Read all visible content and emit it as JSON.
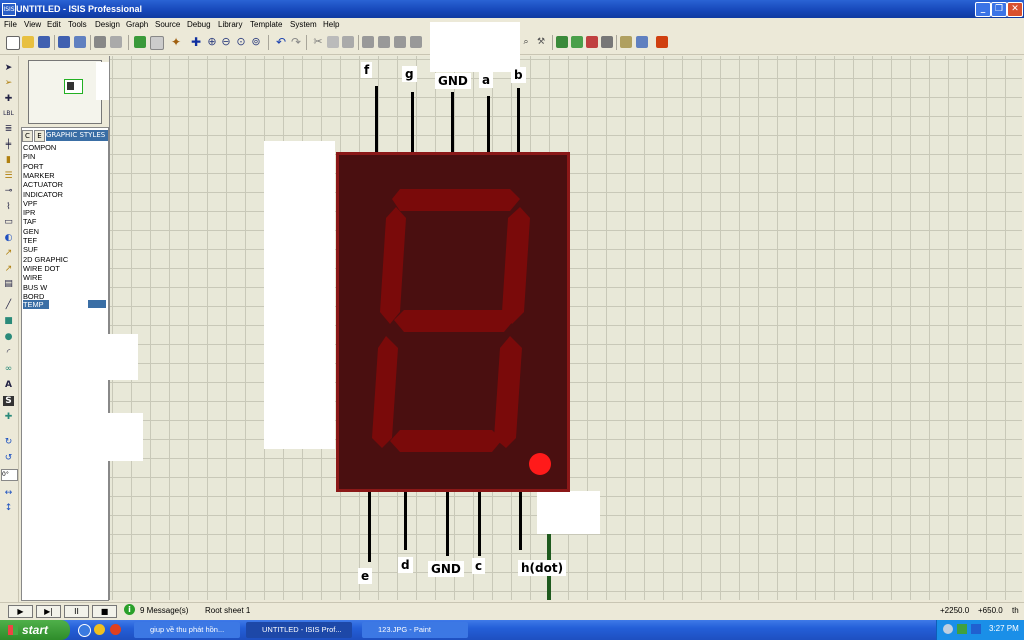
{
  "window": {
    "title": "UNTITLED - ISIS Professional",
    "app_icon_text": "ISIS",
    "controls": [
      "_",
      "❐",
      "✕"
    ]
  },
  "menu": [
    "File",
    "View",
    "Edit",
    "Tools",
    "Design",
    "Graph",
    "Source",
    "Debug",
    "Library",
    "Template",
    "System",
    "Help"
  ],
  "selector": {
    "tab_c": "C",
    "tab_e": "E",
    "title": "GRAPHIC STYLES",
    "items": [
      "COMPON",
      "PIN",
      "PORT",
      "MARKER",
      "ACTUATOR",
      "INDICATOR",
      "VPF",
      "IPR",
      "TAF",
      "GEN",
      "TEF",
      "SUF",
      "2D GRAPHIC",
      "WIRE DOT",
      "WIRE",
      "BUS W",
      "BORD",
      "TEMP"
    ]
  },
  "rotation_value": "0°",
  "display": {
    "top_pins": [
      "f",
      "g",
      "GND",
      "a",
      "b"
    ],
    "bottom_pins": [
      "e",
      "d",
      "GND",
      "c",
      "h(dot)"
    ],
    "segment_color": "#7a0a0a",
    "dot_color": "#ff1a1a",
    "body_color": "#4a0f10"
  },
  "status": {
    "sim_buttons": [
      "▶",
      "▶|",
      "II",
      "■"
    ],
    "messages": "9 Message(s)",
    "sheet": "Root sheet 1",
    "x_coord": "+2250.0",
    "y_coord": "+650.0",
    "unit": "th"
  },
  "taskbar": {
    "start": "start",
    "tasks": [
      "giup về thu phát hồn...",
      "UNTITLED - ISIS Prof...",
      "123.JPG - Paint"
    ],
    "clock": "3:27 PM"
  }
}
